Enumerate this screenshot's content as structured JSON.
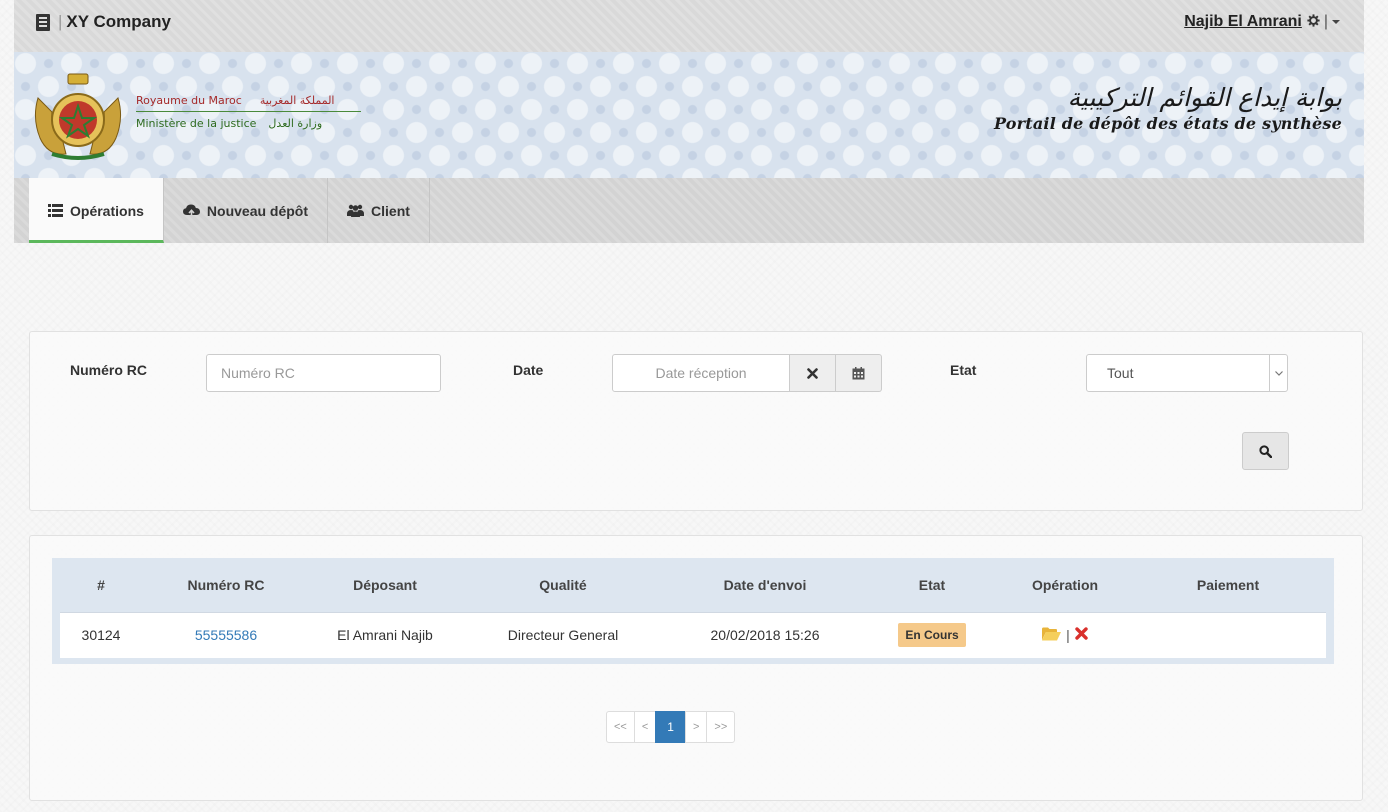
{
  "navbar": {
    "brand": "XY Company",
    "user_name": "Najib El Amrani"
  },
  "banner": {
    "kingdom_fr": "Royaume du Maroc",
    "kingdom_ar": "المملكة المغربية",
    "ministry_fr": "Ministère de la justice",
    "ministry_ar": "وزارة العدل",
    "portal_ar": "بوابة إيداع القوائم التركيبية",
    "portal_fr": "Portail de dépôt des états de synthèse"
  },
  "tabs": [
    {
      "label": "Opérations",
      "icon": "list-icon",
      "active": true
    },
    {
      "label": "Nouveau dépôt",
      "icon": "cloud-upload-icon",
      "active": false
    },
    {
      "label": "Client",
      "icon": "users-icon",
      "active": false
    }
  ],
  "search": {
    "rc_label": "Numéro RC",
    "rc_placeholder": "Numéro RC",
    "date_label": "Date",
    "date_placeholder": "Date réception",
    "state_label": "Etat",
    "state_selected": "Tout"
  },
  "table": {
    "headers": [
      "#",
      "Numéro RC",
      "Déposant",
      "Qualité",
      "Date d'envoi",
      "Etat",
      "Opération",
      "Paiement"
    ],
    "rows": [
      {
        "id": "30124",
        "rc": "55555586",
        "deposant": "El Amrani Najib",
        "qualite": "Directeur General",
        "date_envoi": "20/02/2018 15:26",
        "etat": "En Cours",
        "paiement": ""
      }
    ]
  },
  "pagination": {
    "first": "<<",
    "prev": "<",
    "current": "1",
    "next": ">",
    "last": ">>"
  },
  "colors": {
    "active_tab_underline": "#5cb85c",
    "link": "#337ab7",
    "badge_en_cours": "#f5c98a",
    "delete_icon": "#d9302c",
    "folder_icon": "#f0c24b"
  }
}
